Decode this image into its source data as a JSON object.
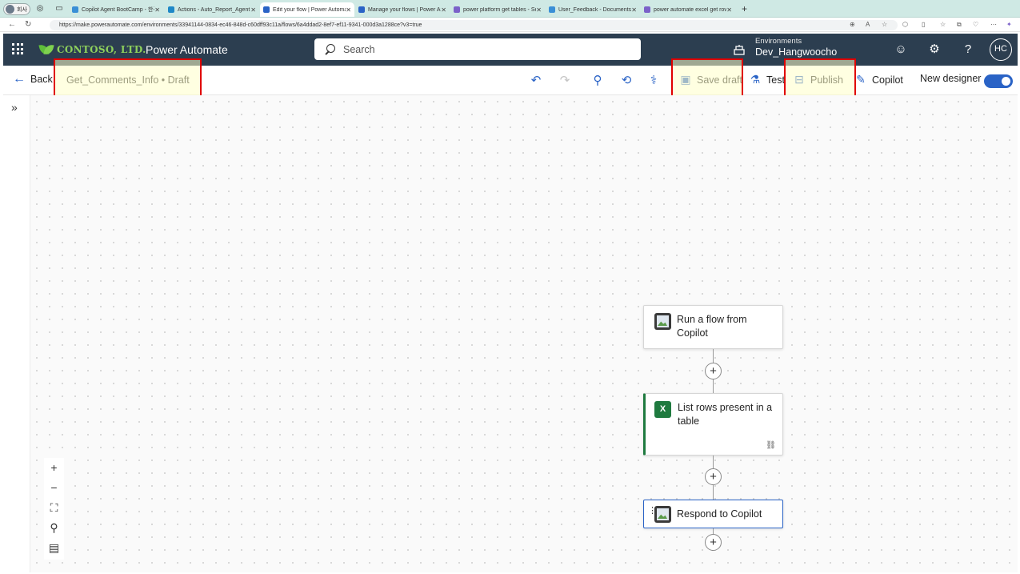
{
  "browser": {
    "profile_label": "회사",
    "tabs": [
      {
        "label": "Copilot Agent BootCamp - 한국",
        "color": "#3a8fd6"
      },
      {
        "label": "Actions - Auto_Report_Agent |",
        "color": "#1e88c7"
      },
      {
        "label": "Edit your flow | Power Automate",
        "color": "#2a63c6"
      },
      {
        "label": "Manage your flows | Power Aut",
        "color": "#2a63c6"
      },
      {
        "label": "power platform get tables - Sea",
        "color": "#7b61c9"
      },
      {
        "label": "User_Feedback - Documents -",
        "color": "#3a8fd6"
      },
      {
        "label": "power automate excel get rows",
        "color": "#7b61c9"
      }
    ],
    "url": "https://make.powerautomate.com/environments/33941144-0834-ec46-848d-c60dff93c11a/flows/6a4ddad2-8ef7-ef11-9341-000d3a1288ce?v3=true"
  },
  "header": {
    "brand": "CONTOSO, LTD.",
    "app_name": "Power Automate",
    "search_placeholder": "Search",
    "env_label": "Environments",
    "env_name": "Dev_Hangwoocho",
    "avatar_initials": "HC"
  },
  "cmdbar": {
    "back_label": "Back",
    "flow_title": "Get_Comments_Info • Draft",
    "save_draft_label": "Save draft",
    "test_label": "Test",
    "publish_label": "Publish",
    "copilot_label": "Copilot",
    "new_designer_label": "New designer",
    "new_designer_on": true
  },
  "flow": {
    "nodes": [
      {
        "title": "Run a flow from Copilot",
        "icon": "image-placeholder-icon"
      },
      {
        "title": "List rows present in a table",
        "icon": "excel-icon"
      },
      {
        "title": "Respond to Copilot",
        "icon": "image-placeholder-icon"
      }
    ]
  },
  "colors": {
    "header_bg": "#2c3e50",
    "accent": "#2a63c6",
    "highlight_border": "#e00000",
    "excel_green": "#1f7a3f"
  }
}
